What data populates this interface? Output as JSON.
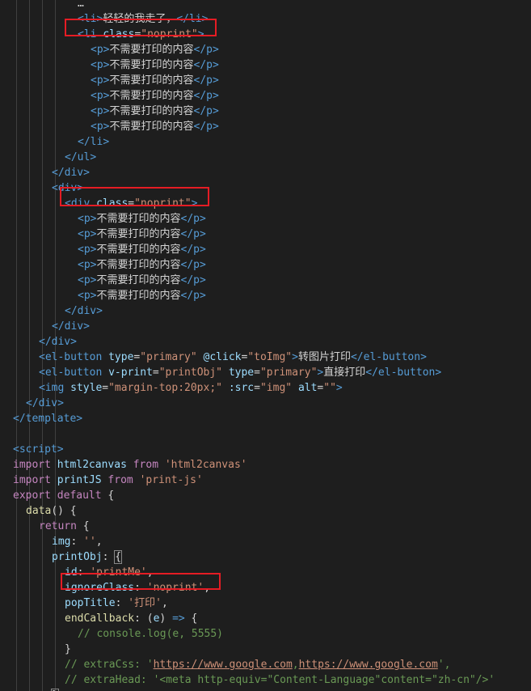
{
  "editor": {
    "theme": "dark",
    "colors": {
      "background": "#1e1e1e",
      "tag": "#569cd6",
      "attribute": "#9cdcfe",
      "string": "#ce9178",
      "keyword": "#c586c0",
      "function": "#dcdcaa",
      "comment": "#6a9955",
      "highlight_box": "#e51c24"
    },
    "lines": [
      {
        "indent": 96,
        "tokens": [
          [
            "t-txt",
            "…"
          ]
        ]
      },
      {
        "indent": 96,
        "tokens": [
          [
            "t-tag",
            "<"
          ],
          [
            "t-tag",
            "li"
          ],
          [
            "t-tag",
            ">"
          ],
          [
            "t-txt",
            "轻轻的我走了，"
          ],
          [
            "t-tag",
            "</"
          ],
          [
            "t-tag",
            "li"
          ],
          [
            "t-tag",
            ">"
          ]
        ]
      },
      {
        "indent": 96,
        "tokens": [
          [
            "t-tag",
            "<"
          ],
          [
            "t-tag",
            "li "
          ],
          [
            "t-attr",
            "class"
          ],
          [
            "t-punc",
            "="
          ],
          [
            "t-str",
            "\"noprint\""
          ],
          [
            "t-tag",
            ">"
          ]
        ]
      },
      {
        "indent": 112,
        "tokens": [
          [
            "t-tag",
            "<"
          ],
          [
            "t-tag",
            "p"
          ],
          [
            "t-tag",
            ">"
          ],
          [
            "t-txt",
            "不需要打印的内容"
          ],
          [
            "t-tag",
            "</"
          ],
          [
            "t-tag",
            "p"
          ],
          [
            "t-tag",
            ">"
          ]
        ]
      },
      {
        "indent": 112,
        "tokens": [
          [
            "t-tag",
            "<"
          ],
          [
            "t-tag",
            "p"
          ],
          [
            "t-tag",
            ">"
          ],
          [
            "t-txt",
            "不需要打印的内容"
          ],
          [
            "t-tag",
            "</"
          ],
          [
            "t-tag",
            "p"
          ],
          [
            "t-tag",
            ">"
          ]
        ]
      },
      {
        "indent": 112,
        "tokens": [
          [
            "t-tag",
            "<"
          ],
          [
            "t-tag",
            "p"
          ],
          [
            "t-tag",
            ">"
          ],
          [
            "t-txt",
            "不需要打印的内容"
          ],
          [
            "t-tag",
            "</"
          ],
          [
            "t-tag",
            "p"
          ],
          [
            "t-tag",
            ">"
          ]
        ]
      },
      {
        "indent": 112,
        "tokens": [
          [
            "t-tag",
            "<"
          ],
          [
            "t-tag",
            "p"
          ],
          [
            "t-tag",
            ">"
          ],
          [
            "t-txt",
            "不需要打印的内容"
          ],
          [
            "t-tag",
            "</"
          ],
          [
            "t-tag",
            "p"
          ],
          [
            "t-tag",
            ">"
          ]
        ]
      },
      {
        "indent": 112,
        "tokens": [
          [
            "t-tag",
            "<"
          ],
          [
            "t-tag",
            "p"
          ],
          [
            "t-tag",
            ">"
          ],
          [
            "t-txt",
            "不需要打印的内容"
          ],
          [
            "t-tag",
            "</"
          ],
          [
            "t-tag",
            "p"
          ],
          [
            "t-tag",
            ">"
          ]
        ]
      },
      {
        "indent": 112,
        "tokens": [
          [
            "t-tag",
            "<"
          ],
          [
            "t-tag",
            "p"
          ],
          [
            "t-tag",
            ">"
          ],
          [
            "t-txt",
            "不需要打印的内容"
          ],
          [
            "t-tag",
            "</"
          ],
          [
            "t-tag",
            "p"
          ],
          [
            "t-tag",
            ">"
          ]
        ]
      },
      {
        "indent": 96,
        "tokens": [
          [
            "t-tag",
            "</"
          ],
          [
            "t-tag",
            "li"
          ],
          [
            "t-tag",
            ">"
          ]
        ]
      },
      {
        "indent": 80,
        "tokens": [
          [
            "t-tag",
            "</"
          ],
          [
            "t-tag",
            "ul"
          ],
          [
            "t-tag",
            ">"
          ]
        ]
      },
      {
        "indent": 64,
        "tokens": [
          [
            "t-tag",
            "</"
          ],
          [
            "t-tag",
            "div"
          ],
          [
            "t-tag",
            ">"
          ]
        ]
      },
      {
        "indent": 64,
        "tokens": [
          [
            "t-tag",
            "<"
          ],
          [
            "t-tag",
            "div"
          ],
          [
            "t-tag",
            ">"
          ]
        ]
      },
      {
        "indent": 80,
        "tokens": [
          [
            "t-tag",
            "<"
          ],
          [
            "t-tag",
            "div "
          ],
          [
            "t-attr",
            "class"
          ],
          [
            "t-punc",
            "="
          ],
          [
            "t-str",
            "\"noprint\""
          ],
          [
            "t-tag",
            ">"
          ]
        ]
      },
      {
        "indent": 96,
        "tokens": [
          [
            "t-tag",
            "<"
          ],
          [
            "t-tag",
            "p"
          ],
          [
            "t-tag",
            ">"
          ],
          [
            "t-txt",
            "不需要打印的内容"
          ],
          [
            "t-tag",
            "</"
          ],
          [
            "t-tag",
            "p"
          ],
          [
            "t-tag",
            ">"
          ]
        ]
      },
      {
        "indent": 96,
        "tokens": [
          [
            "t-tag",
            "<"
          ],
          [
            "t-tag",
            "p"
          ],
          [
            "t-tag",
            ">"
          ],
          [
            "t-txt",
            "不需要打印的内容"
          ],
          [
            "t-tag",
            "</"
          ],
          [
            "t-tag",
            "p"
          ],
          [
            "t-tag",
            ">"
          ]
        ]
      },
      {
        "indent": 96,
        "tokens": [
          [
            "t-tag",
            "<"
          ],
          [
            "t-tag",
            "p"
          ],
          [
            "t-tag",
            ">"
          ],
          [
            "t-txt",
            "不需要打印的内容"
          ],
          [
            "t-tag",
            "</"
          ],
          [
            "t-tag",
            "p"
          ],
          [
            "t-tag",
            ">"
          ]
        ]
      },
      {
        "indent": 96,
        "tokens": [
          [
            "t-tag",
            "<"
          ],
          [
            "t-tag",
            "p"
          ],
          [
            "t-tag",
            ">"
          ],
          [
            "t-txt",
            "不需要打印的内容"
          ],
          [
            "t-tag",
            "</"
          ],
          [
            "t-tag",
            "p"
          ],
          [
            "t-tag",
            ">"
          ]
        ]
      },
      {
        "indent": 96,
        "tokens": [
          [
            "t-tag",
            "<"
          ],
          [
            "t-tag",
            "p"
          ],
          [
            "t-tag",
            ">"
          ],
          [
            "t-txt",
            "不需要打印的内容"
          ],
          [
            "t-tag",
            "</"
          ],
          [
            "t-tag",
            "p"
          ],
          [
            "t-tag",
            ">"
          ]
        ]
      },
      {
        "indent": 96,
        "tokens": [
          [
            "t-tag",
            "<"
          ],
          [
            "t-tag",
            "p"
          ],
          [
            "t-tag",
            ">"
          ],
          [
            "t-txt",
            "不需要打印的内容"
          ],
          [
            "t-tag",
            "</"
          ],
          [
            "t-tag",
            "p"
          ],
          [
            "t-tag",
            ">"
          ]
        ]
      },
      {
        "indent": 80,
        "tokens": [
          [
            "t-tag",
            "</"
          ],
          [
            "t-tag",
            "div"
          ],
          [
            "t-tag",
            ">"
          ]
        ]
      },
      {
        "indent": 64,
        "tokens": [
          [
            "t-tag",
            "</"
          ],
          [
            "t-tag",
            "div"
          ],
          [
            "t-tag",
            ">"
          ]
        ]
      },
      {
        "indent": 48,
        "tokens": [
          [
            "t-tag",
            "</"
          ],
          [
            "t-tag",
            "div"
          ],
          [
            "t-tag",
            ">"
          ]
        ]
      },
      {
        "indent": 48,
        "tokens": [
          [
            "t-tag",
            "<"
          ],
          [
            "t-tag",
            "el-button "
          ],
          [
            "t-attr",
            "type"
          ],
          [
            "t-punc",
            "="
          ],
          [
            "t-str",
            "\"primary\" "
          ],
          [
            "t-attr",
            "@click"
          ],
          [
            "t-punc",
            "="
          ],
          [
            "t-str",
            "\"toImg\""
          ],
          [
            "t-tag",
            ">"
          ],
          [
            "t-txt",
            "转图片打印"
          ],
          [
            "t-tag",
            "</"
          ],
          [
            "t-tag",
            "el-button"
          ],
          [
            "t-tag",
            ">"
          ]
        ]
      },
      {
        "indent": 48,
        "tokens": [
          [
            "t-tag",
            "<"
          ],
          [
            "t-tag",
            "el-button "
          ],
          [
            "t-attr",
            "v-print"
          ],
          [
            "t-punc",
            "="
          ],
          [
            "t-str",
            "\"printObj\" "
          ],
          [
            "t-attr",
            "type"
          ],
          [
            "t-punc",
            "="
          ],
          [
            "t-str",
            "\"primary\""
          ],
          [
            "t-tag",
            ">"
          ],
          [
            "t-txt",
            "直接打印"
          ],
          [
            "t-tag",
            "</"
          ],
          [
            "t-tag",
            "el-button"
          ],
          [
            "t-tag",
            ">"
          ]
        ]
      },
      {
        "indent": 48,
        "tokens": [
          [
            "t-tag",
            "<"
          ],
          [
            "t-tag",
            "img "
          ],
          [
            "t-attr",
            "style"
          ],
          [
            "t-punc",
            "="
          ],
          [
            "t-str",
            "\"margin-top:20px;\" "
          ],
          [
            "t-attr",
            ":src"
          ],
          [
            "t-punc",
            "="
          ],
          [
            "t-str",
            "\"img\" "
          ],
          [
            "t-attr",
            "alt"
          ],
          [
            "t-punc",
            "="
          ],
          [
            "t-str",
            "\"\""
          ],
          [
            "t-tag",
            ">"
          ]
        ]
      },
      {
        "indent": 32,
        "tokens": [
          [
            "t-tag",
            "</"
          ],
          [
            "t-tag",
            "div"
          ],
          [
            "t-tag",
            ">"
          ]
        ]
      },
      {
        "indent": 16,
        "tokens": [
          [
            "t-tag",
            "</"
          ],
          [
            "t-tag",
            "template"
          ],
          [
            "t-tag",
            ">"
          ]
        ]
      },
      {
        "indent": 16,
        "tokens": []
      },
      {
        "indent": 16,
        "tokens": [
          [
            "t-tag",
            "<"
          ],
          [
            "t-tag",
            "script"
          ],
          [
            "t-tag",
            ">"
          ]
        ]
      },
      {
        "indent": 16,
        "tokens": [
          [
            "t-kw",
            "import "
          ],
          [
            "t-attr",
            "html2canvas "
          ],
          [
            "t-kw",
            "from "
          ],
          [
            "t-str",
            "'html2canvas'"
          ]
        ]
      },
      {
        "indent": 16,
        "tokens": [
          [
            "t-kw",
            "import "
          ],
          [
            "t-attr",
            "printJS "
          ],
          [
            "t-kw",
            "from "
          ],
          [
            "t-str",
            "'print-js'"
          ]
        ]
      },
      {
        "indent": 16,
        "tokens": [
          [
            "t-kw",
            "export default "
          ],
          [
            "t-punc",
            "{"
          ]
        ]
      },
      {
        "indent": 32,
        "tokens": [
          [
            "t-fn",
            "data"
          ],
          [
            "t-punc",
            "() {"
          ]
        ]
      },
      {
        "indent": 48,
        "tokens": [
          [
            "t-kw",
            "return "
          ],
          [
            "t-punc",
            "{"
          ]
        ]
      },
      {
        "indent": 64,
        "tokens": [
          [
            "t-attr",
            "img"
          ],
          [
            "t-punc",
            ": "
          ],
          [
            "t-str",
            "''"
          ],
          [
            "t-punc",
            ","
          ]
        ]
      },
      {
        "indent": 64,
        "tokens": [
          [
            "t-attr",
            "printObj"
          ],
          [
            "t-punc",
            ": "
          ],
          [
            "t-brkt",
            "{"
          ]
        ]
      },
      {
        "indent": 80,
        "tokens": [
          [
            "t-attr",
            "id"
          ],
          [
            "t-punc",
            ": "
          ],
          [
            "t-str",
            "'printMe'"
          ],
          [
            "t-punc",
            ","
          ]
        ]
      },
      {
        "indent": 80,
        "tokens": [
          [
            "t-attr",
            "ignoreClass"
          ],
          [
            "t-punc",
            ": "
          ],
          [
            "t-str",
            "'noprint'"
          ],
          [
            "t-punc",
            ","
          ]
        ]
      },
      {
        "indent": 80,
        "tokens": [
          [
            "t-attr",
            "popTitle"
          ],
          [
            "t-punc",
            ": "
          ],
          [
            "t-str",
            "'打印'"
          ],
          [
            "t-punc",
            ","
          ]
        ]
      },
      {
        "indent": 80,
        "tokens": [
          [
            "t-fn",
            "endCallback"
          ],
          [
            "t-punc",
            ": ("
          ],
          [
            "t-attr",
            "e"
          ],
          [
            "t-punc",
            ") "
          ],
          [
            "t-tag",
            "=>"
          ],
          [
            "t-punc",
            " {"
          ]
        ]
      },
      {
        "indent": 96,
        "tokens": [
          [
            "t-cmt",
            "// console.log(e, 5555)"
          ]
        ]
      },
      {
        "indent": 80,
        "tokens": [
          [
            "t-punc",
            "}"
          ]
        ]
      },
      {
        "indent": 80,
        "tokens": [
          [
            "t-cmt",
            "// extraCss: '"
          ],
          [
            "t-url",
            "https://www.google.com"
          ],
          [
            "t-cmt",
            ","
          ],
          [
            "t-url",
            "https://www.google.com"
          ],
          [
            "t-cmt",
            "',"
          ]
        ]
      },
      {
        "indent": 80,
        "tokens": [
          [
            "t-cmt",
            "// extraHead: '<meta http-equiv=\"Content-Language\"content=\"zh-cn\"/>'"
          ]
        ]
      },
      {
        "indent": 64,
        "tokens": [
          [
            "t-brkt",
            "}"
          ]
        ]
      }
    ]
  }
}
